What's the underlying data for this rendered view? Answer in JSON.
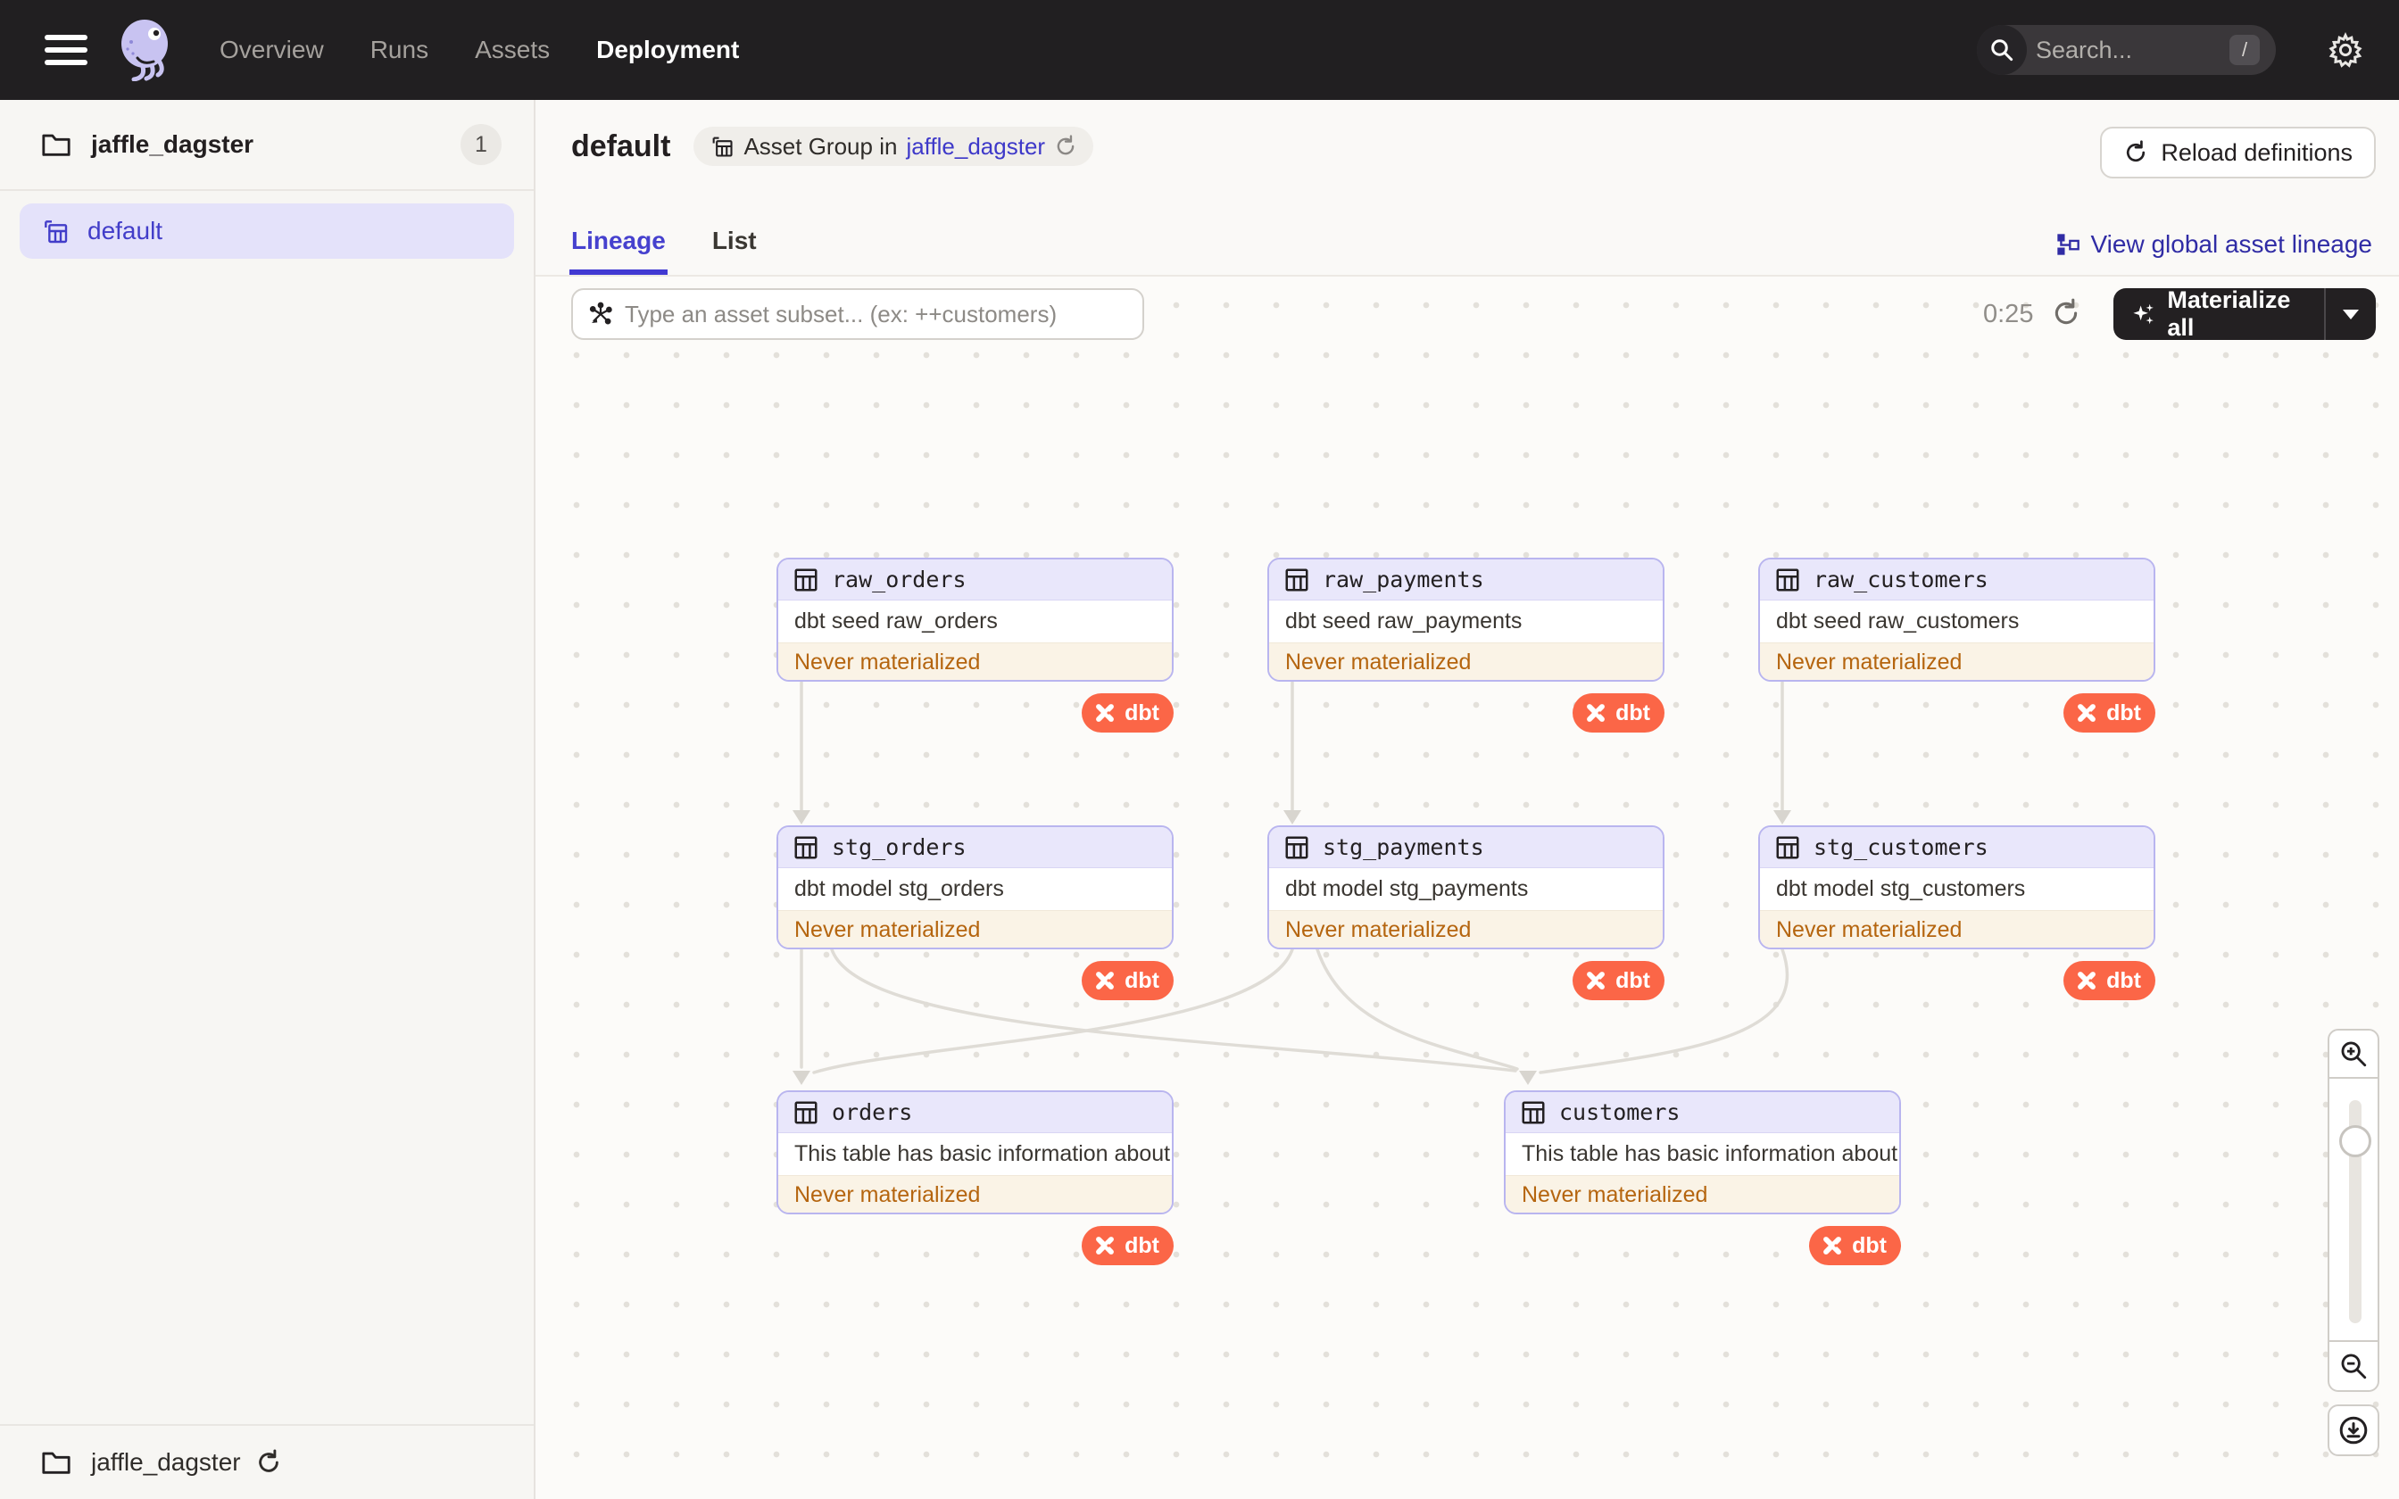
{
  "topbar": {
    "nav": [
      {
        "label": "Overview"
      },
      {
        "label": "Runs"
      },
      {
        "label": "Assets"
      },
      {
        "label": "Deployment"
      }
    ],
    "search": {
      "placeholder": "Search...",
      "shortcut": "/"
    }
  },
  "sidebar": {
    "group": {
      "label": "jaffle_dagster",
      "count": "1"
    },
    "selected_item": {
      "label": "default"
    },
    "footer": {
      "label": "jaffle_dagster"
    }
  },
  "header": {
    "title": "default",
    "tag": {
      "prefix": "Asset Group in",
      "link": "jaffle_dagster"
    },
    "reload_button": "Reload definitions",
    "global_lineage_link": "View global asset lineage"
  },
  "tabs": [
    {
      "label": "Lineage"
    },
    {
      "label": "List"
    }
  ],
  "toolbar": {
    "filter_placeholder": "Type an asset subset... (ex: ++customers)",
    "timer": "0:25",
    "materialize_button": "Materialize all"
  },
  "dbt_label": "dbt",
  "assets": [
    {
      "name": "raw_orders",
      "desc": "dbt seed raw_orders",
      "status": "Never materialized"
    },
    {
      "name": "raw_payments",
      "desc": "dbt seed raw_payments",
      "status": "Never materialized"
    },
    {
      "name": "raw_customers",
      "desc": "dbt seed raw_customers",
      "status": "Never materialized"
    },
    {
      "name": "stg_orders",
      "desc": "dbt model stg_orders",
      "status": "Never materialized"
    },
    {
      "name": "stg_payments",
      "desc": "dbt model stg_payments",
      "status": "Never materialized"
    },
    {
      "name": "stg_customers",
      "desc": "dbt model stg_customers",
      "status": "Never materialized"
    },
    {
      "name": "orders",
      "desc": "This table has basic information about ...",
      "status": "Never materialized"
    },
    {
      "name": "customers",
      "desc": "This table has basic information about ...",
      "status": "Never materialized"
    }
  ],
  "colors": {
    "accent": "#4641CE",
    "topbar": "#211F21",
    "dbt_badge": "#FB6647",
    "status_text": "#B5650F",
    "node_border": "#B9B5EF"
  }
}
